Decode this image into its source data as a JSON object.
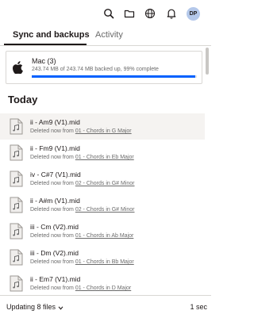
{
  "header": {
    "icons": [
      "search-icon",
      "folder-icon",
      "globe-icon",
      "bell-icon"
    ],
    "avatar_initials": "DP"
  },
  "tabs": [
    {
      "label": "Sync and backups",
      "active": true
    },
    {
      "label": "Activity",
      "active": false
    }
  ],
  "device": {
    "name": "Mac (3)",
    "status": "243.74 MB of 243.74 MB backed up, 99% complete",
    "progress_percent": 99,
    "icon": "apple-icon"
  },
  "section_title": "Today",
  "files": [
    {
      "name": "ii - Am9 (V1).mid",
      "deleted_prefix": "Deleted now from ",
      "folder": "01 - Chords in G Major",
      "selected": true
    },
    {
      "name": "ii - Fm9 (V1).mid",
      "deleted_prefix": "Deleted now from ",
      "folder": "01 - Chords in Eb Major",
      "selected": false
    },
    {
      "name": "iv - C#7 (V1).mid",
      "deleted_prefix": "Deleted now from ",
      "folder": "02 - Chords in G# Minor",
      "selected": false
    },
    {
      "name": "ii - A#m (V1).mid",
      "deleted_prefix": "Deleted now from ",
      "folder": "02 - Chords in G# Minor",
      "selected": false
    },
    {
      "name": "iii - Cm (V2).mid",
      "deleted_prefix": "Deleted now from ",
      "folder": "01 - Chords in Ab Major",
      "selected": false
    },
    {
      "name": "iii - Dm (V2).mid",
      "deleted_prefix": "Deleted now from ",
      "folder": "01 - Chords in Bb Major",
      "selected": false
    },
    {
      "name": "ii - Em7 (V1).mid",
      "deleted_prefix": "Deleted now from ",
      "folder": "01 - Chords in D Major",
      "selected": false
    }
  ],
  "footer": {
    "status": "Updating 8 files",
    "time": "1 sec"
  },
  "colors": {
    "accent": "#0061fe",
    "text": "#1e1919",
    "muted": "#6b6b6b",
    "selected_row": "#f5f3f1"
  }
}
